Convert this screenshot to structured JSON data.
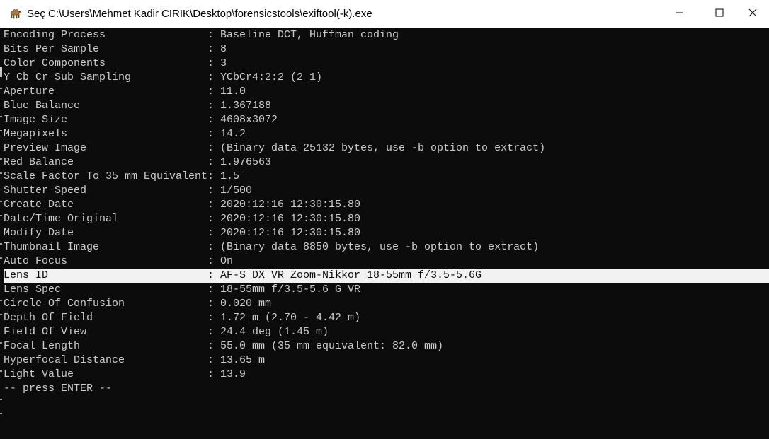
{
  "window": {
    "title": "Seç C:\\Users\\Mehmet Kadir CIRIK\\Desktop\\forensicstools\\exiftool(-k).exe",
    "app_icon": "camel-icon",
    "controls": [
      "minimize-icon",
      "maximize-icon",
      "close-icon"
    ]
  },
  "console": {
    "separator": ":",
    "rows": [
      {
        "key": "Encoding Process",
        "value": "Baseline DCT, Huffman coding"
      },
      {
        "key": "Bits Per Sample",
        "value": "8"
      },
      {
        "key": "Color Components",
        "value": "3"
      },
      {
        "key": "Y Cb Cr Sub Sampling",
        "value": "YCbCr4:2:2 (2 1)"
      },
      {
        "key": "Aperture",
        "value": "11.0"
      },
      {
        "key": "Blue Balance",
        "value": "1.367188"
      },
      {
        "key": "Image Size",
        "value": "4608x3072"
      },
      {
        "key": "Megapixels",
        "value": "14.2"
      },
      {
        "key": "Preview Image",
        "value": "(Binary data 25132 bytes, use -b option to extract)"
      },
      {
        "key": "Red Balance",
        "value": "1.976563"
      },
      {
        "key": "Scale Factor To 35 mm Equivalent",
        "value": "1.5"
      },
      {
        "key": "Shutter Speed",
        "value": "1/500"
      },
      {
        "key": "Create Date",
        "value": "2020:12:16 12:30:15.80"
      },
      {
        "key": "Date/Time Original",
        "value": "2020:12:16 12:30:15.80"
      },
      {
        "key": "Modify Date",
        "value": "2020:12:16 12:30:15.80"
      },
      {
        "key": "Thumbnail Image",
        "value": "(Binary data 8850 bytes, use -b option to extract)"
      },
      {
        "key": "Auto Focus",
        "value": "On"
      },
      {
        "key": "Lens ID",
        "value": "AF-S DX VR Zoom-Nikkor 18-55mm f/3.5-5.6G",
        "selected": true
      },
      {
        "key": "Lens Spec",
        "value": "18-55mm f/3.5-5.6 G VR"
      },
      {
        "key": "Circle Of Confusion",
        "value": "0.020 mm"
      },
      {
        "key": "Depth Of Field",
        "value": "1.72 m (2.70 - 4.42 m)"
      },
      {
        "key": "Field Of View",
        "value": "24.4 deg (1.45 m)"
      },
      {
        "key": "Focal Length",
        "value": "55.0 mm (35 mm equivalent: 82.0 mm)"
      },
      {
        "key": "Hyperfocal Distance",
        "value": "13.65 m"
      },
      {
        "key": "Light Value",
        "value": "13.9"
      }
    ],
    "prompt": "-- press ENTER --"
  },
  "colors": {
    "console_bg": "#0c0c0c",
    "console_fg": "#cccccc",
    "selection_bg": "#f2f2f2",
    "titlebar_bg": "#ffffff"
  }
}
